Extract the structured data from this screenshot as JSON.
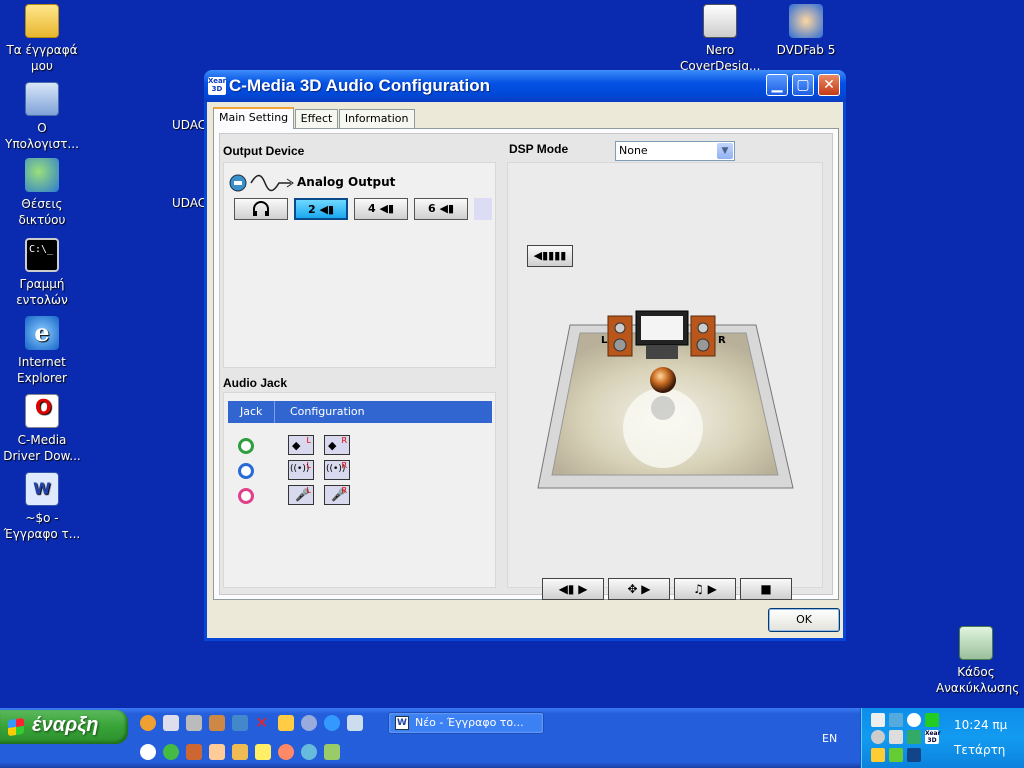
{
  "desktop": {
    "icons_left": [
      {
        "label_line1": "Τα έγγραφά",
        "label_line2": "μου",
        "icon": "my-documents-icon"
      },
      {
        "label_line1": "Ο",
        "label_line2": "Υπολογιστ...",
        "icon": "my-computer-icon"
      },
      {
        "label_line1": "Θέσεις",
        "label_line2": "δικτύου",
        "icon": "network-places-icon"
      },
      {
        "label_line1": "Γραμμή",
        "label_line2": "εντολών",
        "icon": "command-prompt-icon"
      },
      {
        "label_line1": "Internet",
        "label_line2": "Explorer",
        "icon": "internet-explorer-icon"
      },
      {
        "label_line1": "C-Media",
        "label_line2": "Driver Dow...",
        "icon": "cmedia-driver-icon"
      },
      {
        "label_line1": "~$o -",
        "label_line2": "Έγγραφο τ...",
        "icon": "word-document-icon"
      }
    ],
    "icons_top_right": [
      {
        "label_line1": "Nero",
        "label_line2": "CoverDesig...",
        "icon": "nero-coverdesigner-icon"
      },
      {
        "label_line1": "DVDFab 5",
        "label_line2": "",
        "icon": "dvdfab-icon"
      }
    ],
    "recycle_bin": {
      "label_line1": "Κάδος",
      "label_line2": "Ανακύκλωσης"
    },
    "partial_labels": [
      "UDAC",
      "UDAC"
    ]
  },
  "window": {
    "title": "C-Media 3D Audio Configuration",
    "app_icon_text": "Xear 3D",
    "tabs": [
      "Main Setting",
      "Effect",
      "Information"
    ],
    "active_tab": "Main Setting",
    "output_device": {
      "title": "Output Device",
      "mode": "Analog Output",
      "speaker_buttons": [
        {
          "label": "",
          "icon": "headphones-icon",
          "selected": false
        },
        {
          "label": "2",
          "icon": "speaker-icon",
          "selected": true
        },
        {
          "label": "4",
          "icon": "speaker-icon",
          "selected": false
        },
        {
          "label": "6",
          "icon": "speaker-icon",
          "selected": false
        }
      ]
    },
    "dsp_mode": {
      "label": "DSP Mode",
      "value": "None"
    },
    "audio_jack": {
      "title": "Audio Jack",
      "columns": [
        "Jack",
        "Configuration"
      ],
      "rows": [
        {
          "jack_color": "#2e9e3e",
          "cfg_left": "L",
          "cfg_right": "R",
          "icon": "front-speaker-icon"
        },
        {
          "jack_color": "#2a6ad8",
          "cfg_left": "L",
          "cfg_right": "R",
          "icon": "line-in-icon"
        },
        {
          "jack_color": "#e0408a",
          "cfg_left": "L",
          "cfg_right": "R",
          "icon": "microphone-icon"
        }
      ]
    },
    "room": {
      "left_label": "L",
      "right_label": "R"
    },
    "ok_label": "OK"
  },
  "taskbar": {
    "start_label": "έναρξη",
    "task_item": "Νέο - Έγγραφο το...",
    "language": "EN",
    "clock": "10:24 πμ",
    "day": "Τετάρτη"
  },
  "colors": {
    "desktop": "#0a2bb0",
    "titlebar": "#0552e4",
    "selected_speaker": "#1aa8f0"
  }
}
